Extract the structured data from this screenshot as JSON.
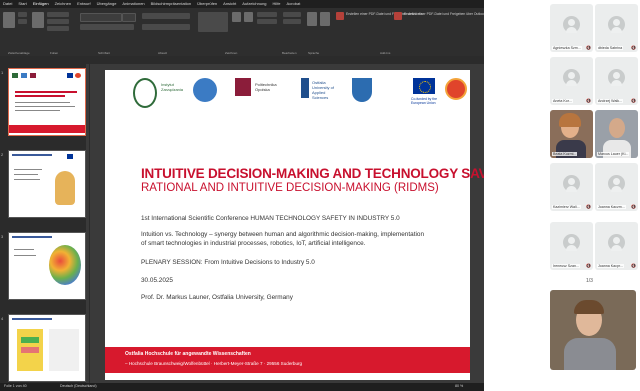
{
  "menu": [
    "Datei",
    "Start",
    "Einfügen",
    "Zeichnen",
    "Entwurf",
    "Übergänge",
    "Animationen",
    "Bildschirmpräsentation",
    "Überprüfen",
    "Ansicht",
    "Aufzeichnung",
    "Hilfe",
    "Acrobat"
  ],
  "menu_active_index": 2,
  "ribbon": {
    "group_labels": [
      "Zwischenablage",
      "Folien",
      "Schriftart",
      "Absatz",
      "Zeichnen",
      "Bearbeiten",
      "Sprache",
      "Add-Ins"
    ],
    "texts": [
      "Erstellen einer PDF-Datei und Freigeben des Links",
      "Erstellen einer PDF-Datei und Freigeben über Outlook"
    ]
  },
  "slide_thumbs": [
    {
      "num": "1",
      "title": "INTUITIVE DECISION-MAKING AND TECHNOLOGY SAVETY"
    },
    {
      "num": "2",
      "title": ""
    },
    {
      "num": "3",
      "title": ""
    },
    {
      "num": "4",
      "title": ""
    },
    {
      "num": "5",
      "title": ""
    }
  ],
  "slide": {
    "logos": [
      {
        "name": "Instytut Zarządzania",
        "color": "#2f6b3a"
      },
      {
        "name": "MTZ",
        "color": "#3b7bc4"
      },
      {
        "name": "Politechnika Opolska",
        "color": "#8b1d3a"
      },
      {
        "name": "Ostfalia",
        "color": "#1f4e8c"
      },
      {
        "name": "crest-icon",
        "color": "#2c6cb0"
      },
      {
        "name": "eu-flag-icon",
        "color": "#003399"
      },
      {
        "name": "circle-logo-icon",
        "color": "#e0442b"
      }
    ],
    "logo_texts": [
      "Instytut Zarządzania",
      "Politechnika Opolska",
      "Ostfalia University of Applied Sciences",
      "Co-funded by the European Union"
    ],
    "title1": "INTUITIVE DECISION-MAKING AND TECHNOLOGY SAVETY",
    "title2": "RATIONAL AND INTUITIVE DECISION-MAKING (RIDMS)",
    "conference": "1st International Scientific Conference HUMAN TECHNOLOGY SAFETY IN INDUSTRY 5.0",
    "intuition_line1": "Intuition vs. Technology – synergy between human and algorithmic decision-making, implementation",
    "intuition_line2": "of smart technologies in industrial processes, robotics, IoT, artificial intelligence.",
    "plenary": "PLENARY SESSION: From Intuitive Decisions to Industry 5.0",
    "date": "30.05.2025",
    "speaker": "Prof. Dr. Markus Launer, Ostfalia University, Germany",
    "footer1": "Ostfalia Hochschule für angewandte Wissenschaften",
    "footer2": "– Hochschule Braunschweig/Wolfenbüttel · Herbert-Meyer-Straße 7 · 29556 Suderburg"
  },
  "status": {
    "slide_info": "Folie 1 von 40",
    "language": "Deutsch (Deutschland)",
    "zoom": "80 %"
  },
  "participants": [
    {
      "name": "Agnieszka Szm...",
      "video": false
    },
    {
      "name": "dbieda Sabrina",
      "video": false
    },
    {
      "name": "Aneta Kor...",
      "video": false
    },
    {
      "name": "Andrzej Walk...",
      "video": false
    },
    {
      "name": "Beata Kubiak...",
      "video": false
    },
    {
      "name": "Emil Kazmi...",
      "video": false
    },
    {
      "name": "Beata Kuzmi...",
      "video": true
    },
    {
      "name": "Marcus Lauer (Ki...",
      "video": true
    },
    {
      "name": "Kazimierz Wali...",
      "video": false
    },
    {
      "name": "Joanna Kaczm...",
      "video": false
    },
    {
      "name": "Ireneusz Szan...",
      "video": false
    },
    {
      "name": "Joanna Kacpr...",
      "video": false
    }
  ],
  "pager": "1/3"
}
